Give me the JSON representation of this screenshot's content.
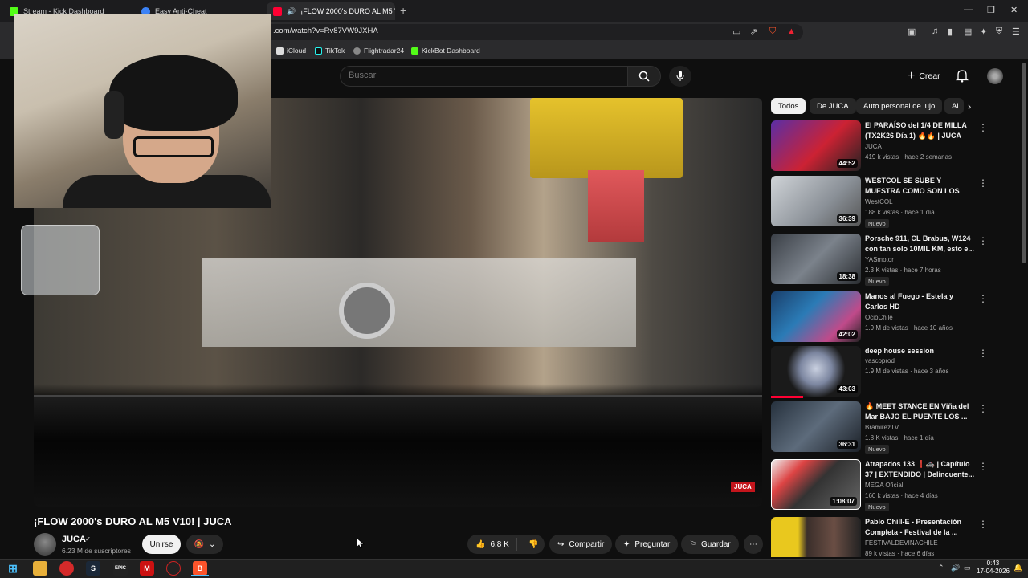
{
  "browser": {
    "tabs": [
      {
        "label": "Stream - Kick Dashboard"
      },
      {
        "label": "Easy Anti-Cheat"
      },
      {
        "label": "¡FLOW 2000's DURO AL M5 V"
      }
    ],
    "url": ".com/watch?v=Rv87VW9JXHA",
    "bookmarks": [
      "iCloud",
      "TikTok",
      "Flightradar24",
      "KickBot Dashboard"
    ]
  },
  "header": {
    "search_placeholder": "Buscar",
    "create_label": "Crear"
  },
  "video": {
    "watermark": "JUCA",
    "title": "¡FLOW 2000's DURO AL M5 V10! | JUCA"
  },
  "channel": {
    "name": "JUCA",
    "subscribers": "6.23 M de suscriptores",
    "join_label": "Unirse"
  },
  "actions": {
    "likes": "6.8 K",
    "share": "Compartir",
    "ask": "Preguntar",
    "save": "Guardar"
  },
  "chips": [
    "Todos",
    "De JUCA",
    "Auto personal de lujo",
    "Ai"
  ],
  "recommendations": [
    {
      "title": "El PARAÍSO del 1/4 DE MILLA (TX2K26 Día 1) 🔥🔥 | JUCA",
      "channel": "JUCA",
      "meta": "419 k vistas · hace 2 semanas",
      "duration": "44:52",
      "badge": ""
    },
    {
      "title": "WESTCOL SE SUBE Y MUESTRA COMO SON LOS CARROS ...",
      "channel": "WestCOL",
      "meta": "188 k vistas · hace 1 día",
      "duration": "36:39",
      "badge": "Nuevo"
    },
    {
      "title": "Porsche 911, CL Brabus, W124 con tan solo 10MIL KM, esto e...",
      "channel": "YASmotor",
      "meta": "2.3 K vistas · hace 7 horas",
      "duration": "18:38",
      "badge": "Nuevo"
    },
    {
      "title": "Manos al Fuego - Estela y Carlos HD",
      "channel": "OcioChile",
      "meta": "1.9 M de vistas · hace 10 años",
      "duration": "42:02",
      "badge": ""
    },
    {
      "title": "deep house session",
      "channel": "vascoprod",
      "meta": "1.9 M de vistas · hace 3 años",
      "duration": "43:03",
      "badge": ""
    },
    {
      "title": "🔥 MEET STANCE EN Viña del Mar BAJO EL PUENTE LOS ...",
      "channel": "BramirezTV",
      "meta": "1.8 K vistas · hace 1 día",
      "duration": "36:31",
      "badge": "Nuevo"
    },
    {
      "title": "Atrapados 133 ❗🚓 | Capítulo 37 | EXTENDIDO | Delincuente...",
      "channel": "MEGA Oficial",
      "meta": "160 k vistas · hace 4 días",
      "duration": "1:08:07",
      "badge": "Nuevo"
    },
    {
      "title": "Pablo Chill-E - Presentación Completa - Festival de la ...",
      "channel": "FESTIVALDEVINACHILE",
      "meta": "89 k vistas · hace 6 días",
      "duration": "",
      "badge": ""
    }
  ],
  "taskbar": {
    "time": "0:43",
    "date": "17-04-2026"
  },
  "colors": {
    "background": "#0f0f0f",
    "accent_red": "#ff0033",
    "chip_active": "#f1f1f1"
  }
}
